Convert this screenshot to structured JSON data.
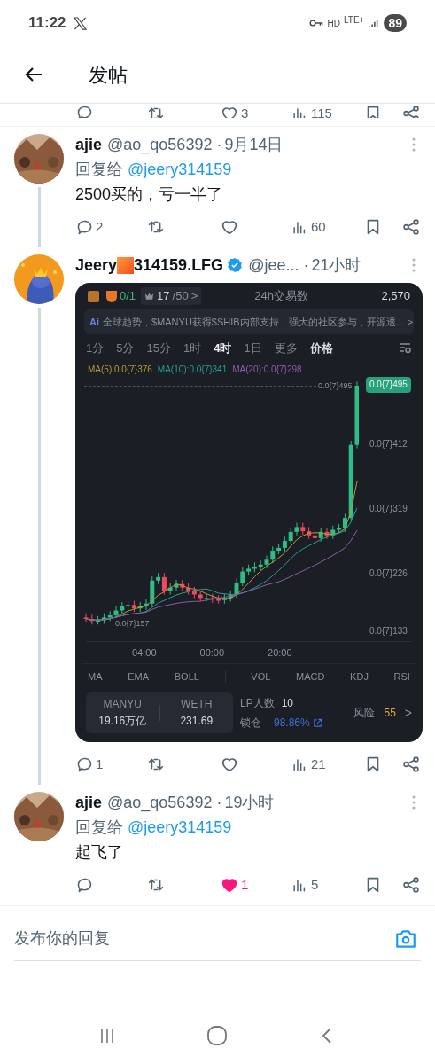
{
  "status_bar": {
    "time": "11:22",
    "hd": "HD",
    "network": "LTE+",
    "battery": "89"
  },
  "header": {
    "title": "发帖"
  },
  "previous_actions": {
    "likes": "3",
    "views": "115"
  },
  "posts": [
    {
      "kind": "text",
      "name": "ajie",
      "handle": "@ao_qo56392",
      "dot": "·",
      "time": "9月14日",
      "reply_label": "回复给",
      "reply_to": "@jeery314159",
      "text": "2500买的，亏一半了",
      "thread_below": true,
      "actions": {
        "replies": "2",
        "views": "60",
        "liked": false
      }
    },
    {
      "kind": "chart",
      "name": "Jeery",
      "name_after": "314159.LFG",
      "handle": "@jee...",
      "dot": "·",
      "time": "21小时",
      "verified": true,
      "thread_below": true,
      "actions": {
        "replies": "1",
        "views": "21",
        "liked": false
      }
    },
    {
      "kind": "text",
      "name": "ajie",
      "handle": "@ao_qo56392",
      "dot": "·",
      "time": "19小时",
      "reply_label": "回复给",
      "reply_to": "@jeery314159",
      "text": "起飞了",
      "actions": {
        "likes": "1",
        "views": "5",
        "liked": true
      }
    }
  ],
  "chart_card": {
    "counter": "0/1",
    "rank": "17",
    "rank_total": "/50",
    "rank_arrow": ">",
    "stat_label": "24h交易数",
    "stat_value": "2,570",
    "ai_badge": "Ai",
    "ai_text": "全球趋势，$MANYU获得$SHIB内部支持，强大的社区参与，开源透...",
    "ai_arrow": ">",
    "intervals": [
      {
        "label": "1分",
        "selected": false
      },
      {
        "label": "5分",
        "selected": false
      },
      {
        "label": "15分",
        "selected": false
      },
      {
        "label": "1时",
        "selected": false
      },
      {
        "label": "4时",
        "selected": true
      },
      {
        "label": "1日",
        "selected": false
      }
    ],
    "more": "更多",
    "price": "价格",
    "ma_legend": [
      {
        "label": "MA(5):0.0{7}376",
        "color": "#b59a3a"
      },
      {
        "label": "MA(10):0.0{7}341",
        "color": "#2a9d8f"
      },
      {
        "label": "MA(20):0.0{7}298",
        "color": "#8e5ca8"
      }
    ],
    "last_line_label": "0.0{7}495",
    "last_tag": "0.0{7}495",
    "y_labels": [
      "0.0{7}412",
      "0.0{7}319",
      "0.0{7}226",
      "0.0{7}133"
    ],
    "low_label": "0.0{7}157",
    "x_labels": [
      "04:00",
      "00:00",
      "20:00"
    ],
    "indicators": [
      "MA",
      "EMA",
      "BOLL",
      "VOL",
      "MACD",
      "KDJ",
      "RSI"
    ],
    "pair": [
      {
        "symbol": "MANYU",
        "amount": "19.16万亿"
      },
      {
        "symbol": "WETH",
        "amount": "231.69"
      }
    ],
    "lp_label": "LP人数",
    "lp_value": "10",
    "lock_label": "锁仓",
    "lock_value": "98.86%",
    "risk_label": "风险",
    "risk_value": "55",
    "risk_arrow": ">"
  },
  "reply_bar": {
    "placeholder": "发布你的回复"
  }
}
